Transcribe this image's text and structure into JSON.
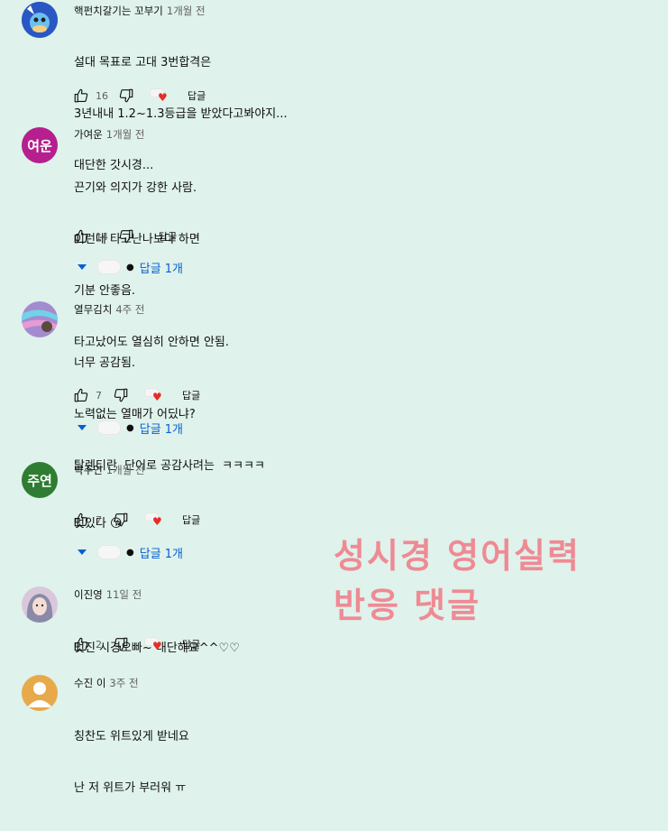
{
  "colors": {
    "background": "#dff2eb",
    "link": "#065fd4",
    "overlay": "#ef8a94",
    "heart": "#e52d27"
  },
  "overlay": {
    "line1": "성시경 영어실력",
    "line2": "반응 댓글"
  },
  "comments": [
    {
      "author": "핵펀치갈기는 꼬부기",
      "time": "1개월 전",
      "lines": [
        "설대 목표로 고대 3번합격은",
        "3년내내 1.2~1.3등급을 받았다고봐야지...",
        "대단한 갓시경..."
      ],
      "likes": "16",
      "reply_label": "답글",
      "avatar_icon": "squirtle-avatar-icon"
    },
    {
      "author": "가여운",
      "time": "1개월 전",
      "avatar_text": "여운",
      "avatar_color": "#b5208e",
      "lines": [
        "끈기와 의지가 강한 사람.",
        "이런데 타고난나보다 하면",
        "기분 안좋음.",
        "타고났어도 열심히 안하면 안됨."
      ],
      "likes": "14",
      "reply_label": "답글",
      "replies_label": "답글 1개"
    },
    {
      "author": "열무김치",
      "time": "4주 전",
      "lines": [
        "너무 공감됨.",
        "노력없는 열매가 어딨냐?",
        "탈렌티란  단어로 공감사려는  ㅋㅋㅋㅋ"
      ],
      "likes": "7",
      "reply_label": "답글",
      "replies_label": "답글 1개",
      "avatar_icon": "photo-avatar-icon"
    },
    {
      "author": "박주연",
      "time": "1개월 전",
      "avatar_text": "주연",
      "avatar_color": "#2e7d32",
      "lines": [
        "멋있다 😘"
      ],
      "likes": "7",
      "reply_label": "답글",
      "replies_label": "답글 1개"
    },
    {
      "author": "이진영",
      "time": "11일 전",
      "lines": [
        "멋진 시경오빠~ 대단해요^^♡♡"
      ],
      "likes": "2",
      "reply_label": "답글",
      "avatar_icon": "photo-avatar-icon"
    },
    {
      "author": "수진 이",
      "time": "3주 전",
      "lines": [
        "칭찬도 위트있게 받네요",
        "난 저 위트가 부러워 ㅠ"
      ],
      "avatar_icon": "default-user-icon",
      "avatar_color": "#e8a94a"
    }
  ]
}
